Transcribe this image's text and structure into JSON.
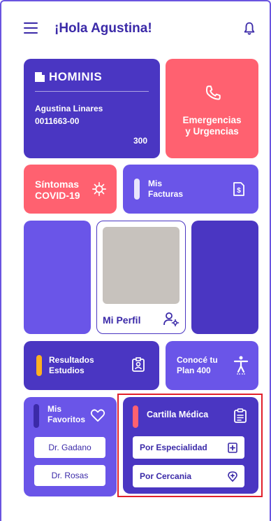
{
  "header": {
    "title": "¡Hola Agustina!"
  },
  "hominis_card": {
    "brand": "HOMINIS",
    "member_name": "Agustina Linares",
    "member_id": "0011663-00",
    "plan_number": "300"
  },
  "tiles": {
    "emergencias": {
      "line1": "Emergencias",
      "line2": "y Urgencias"
    },
    "covid": {
      "line1": "Síntomas",
      "line2": "COVID-19"
    },
    "facturas": {
      "line1": "Mis",
      "line2": "Facturas"
    },
    "perfil": {
      "label": "Mi Perfil"
    },
    "resultados": {
      "line1": "Resultados",
      "line2": "Estudios"
    },
    "conoce": {
      "line1": "Conocé tu",
      "line2": "Plan 400"
    },
    "favoritos": {
      "line1": "Mis",
      "line2": "Favoritos",
      "doctors": [
        "Dr. Gadano",
        "Dr. Rosas"
      ]
    },
    "cartilla": {
      "title": "Cartilla Médica",
      "options": [
        "Por Especialidad",
        "Por Cercania"
      ]
    }
  },
  "colors": {
    "primary": "#6a55e8",
    "primary_dark": "#4a36c2",
    "coral": "#ff6170",
    "accent_yellow": "#ffb020",
    "highlight_red": "#e11f2b"
  },
  "icons": [
    "menu-icon",
    "bell-icon",
    "phone-icon",
    "virus-icon",
    "invoice-icon",
    "user-settings-icon",
    "id-badge-icon",
    "accessibility-icon",
    "heart-icon",
    "clipboard-icon",
    "medical-plus-icon",
    "location-pin-icon"
  ]
}
